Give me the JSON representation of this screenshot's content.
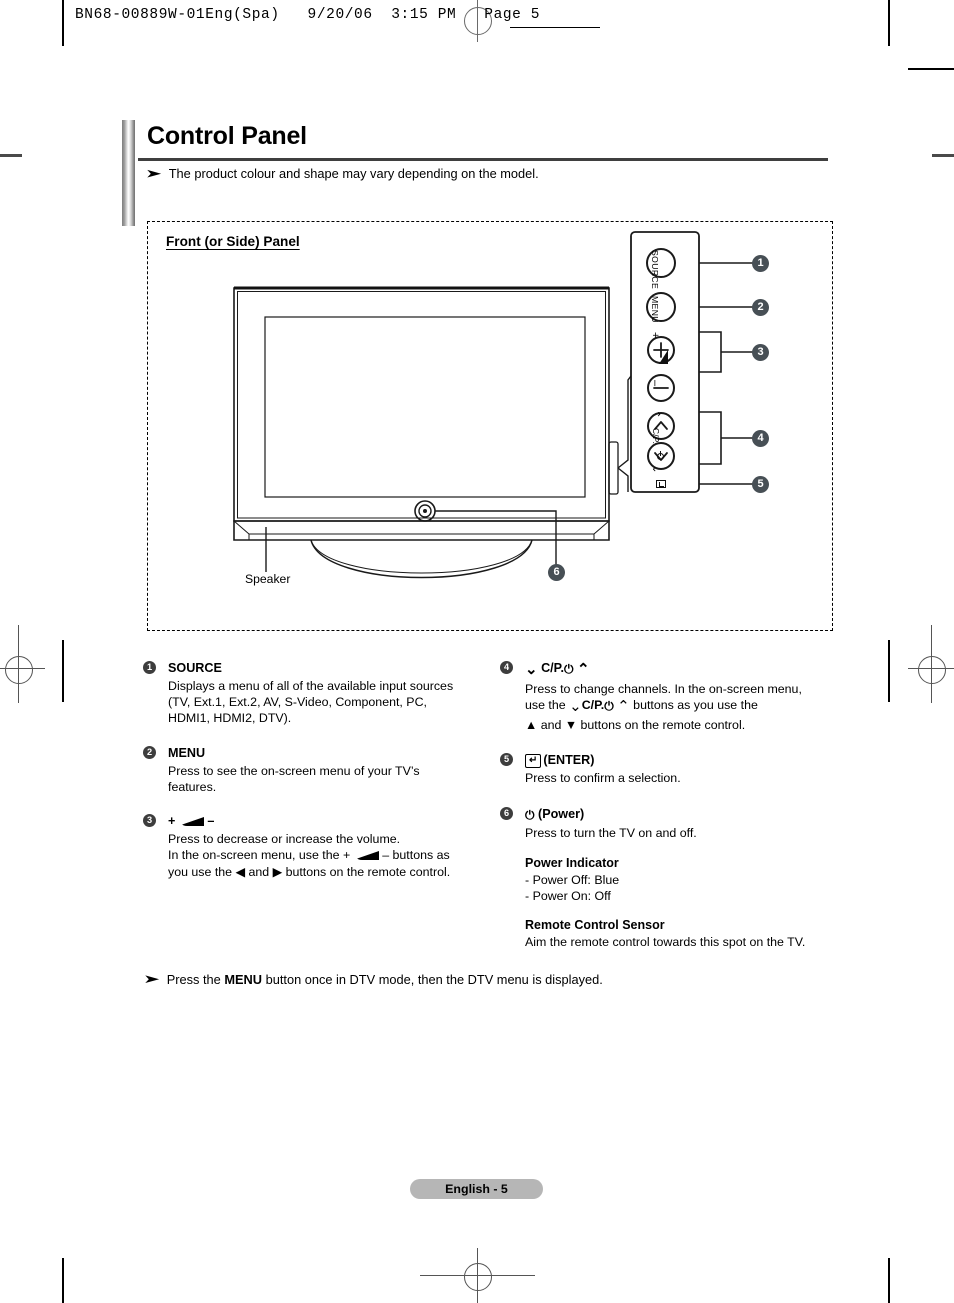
{
  "print_header": {
    "text": "BN68-00889W-01Eng(Spa)   9/20/06  3:15 PM   Page 5"
  },
  "title": {
    "heading": "Control Panel",
    "note_arrow": "➤",
    "note": "The product colour and shape may vary depending on the model."
  },
  "panel": {
    "heading": "Front (or Side) Panel",
    "speaker_label": "Speaker",
    "button_labels": {
      "source": "SOURCE",
      "menu": "MENU",
      "volume_plus": "+",
      "volume_minus": "–",
      "channel_up": "⌃",
      "channel_down": "⌄",
      "channel_text": "C/P.",
      "enter": "↵"
    },
    "callouts": [
      "1",
      "2",
      "3",
      "4",
      "5",
      "6"
    ]
  },
  "descriptions": {
    "left": [
      {
        "num": "1",
        "head": "SOURCE",
        "lines": [
          "Displays a menu of all of the available input sources",
          "(TV, Ext.1, Ext.2, AV, S-Video, Component, PC,",
          "HDMI1, HDMI2, DTV)."
        ]
      },
      {
        "num": "2",
        "head": "MENU",
        "lines": [
          "Press to see the on-screen menu of your TV’s",
          "features."
        ]
      },
      {
        "num": "3",
        "head_prefix": "+",
        "head_suffix": "–",
        "lines": [
          "Press to decrease or increase the volume.",
          "In the on-screen menu, use the +",
          "– buttons as",
          "you use the ◀ and ▶ buttons on the remote control."
        ]
      }
    ],
    "right": [
      {
        "num": "4",
        "head_a": "⌄",
        "head_b": "C/P.",
        "head_c": "⏻",
        "head_d": "⌃",
        "lines": [
          "Press to change channels. In the on-screen menu,",
          "use the",
          "C/P.",
          "buttons as you use the",
          "▲ and ▼ buttons on the remote control."
        ]
      },
      {
        "num": "5",
        "head": "(ENTER)",
        "lines": [
          "Press to confirm a selection."
        ]
      },
      {
        "num": "6",
        "head": "(Power)",
        "lines": [
          "Press to turn the TV on and off."
        ]
      }
    ],
    "power_indicator": {
      "head": "Power Indicator",
      "lines": [
        "- Power Off: Blue",
        "- Power On: Off"
      ]
    },
    "remote_sensor": {
      "head": "Remote Control Sensor",
      "lines": [
        "Aim the remote control towards this spot on the TV."
      ]
    }
  },
  "footer": {
    "arrow": "➤",
    "note_pre": "Press the ",
    "note_bold": "MENU",
    "note_post": " button once in DTV mode, then the DTV menu is displayed.",
    "page_label": "English - 5"
  }
}
